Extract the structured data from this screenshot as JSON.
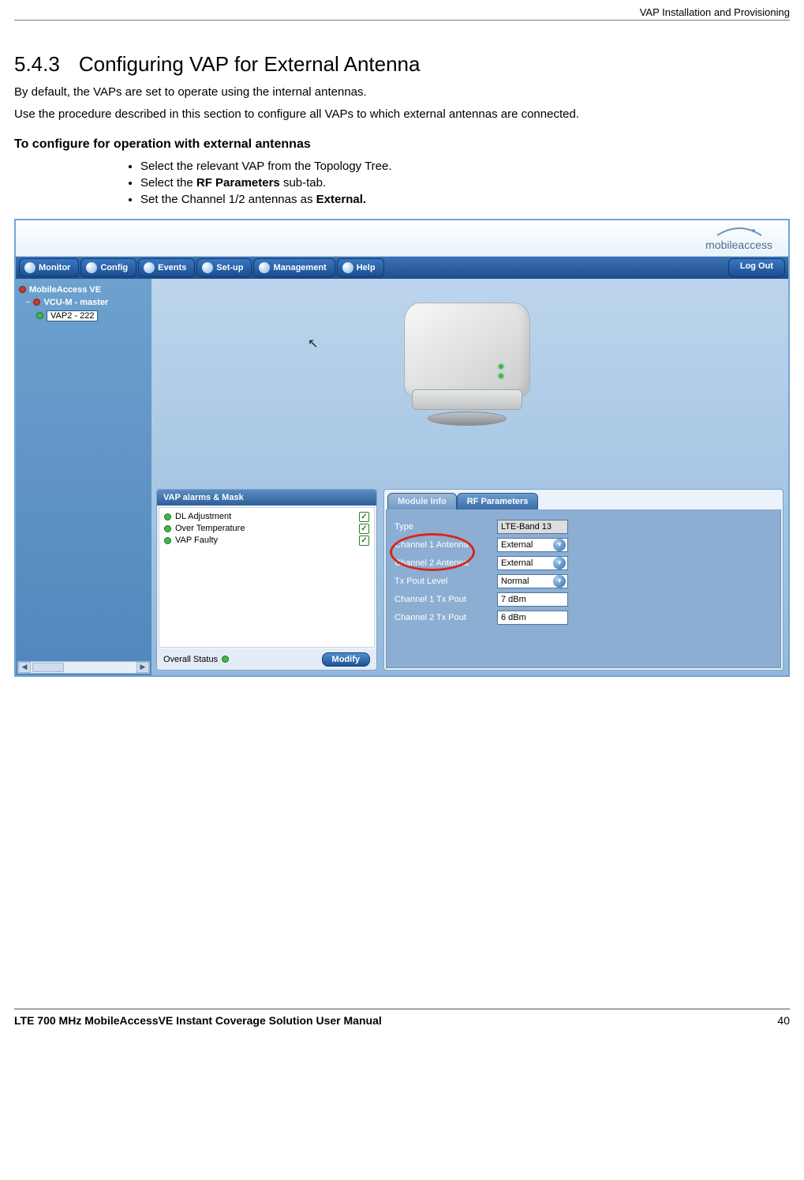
{
  "header": {
    "right": "VAP Installation and Provisioning"
  },
  "section": {
    "num": "5.4.3",
    "title": "Configuring VAP for External Antenna"
  },
  "paras": {
    "p1": "By default, the VAPs are set to operate using the internal antennas.",
    "p2": "Use the procedure described in this section to configure all VAPs to which external antennas are connected.",
    "sub": "To configure for operation with external antennas"
  },
  "bullets": {
    "b1": "Select the relevant VAP from the Topology Tree.",
    "b2_a": "Select the ",
    "b2_b": "RF Parameters",
    "b2_c": " sub-tab.",
    "b3_a": "Set the Channel 1/2 antennas as ",
    "b3_b": "External."
  },
  "brand": "mobileaccess",
  "nav": {
    "monitor": "Monitor",
    "config": "Config",
    "events": "Events",
    "setup": "Set-up",
    "management": "Management",
    "help": "Help",
    "logout": "Log Out"
  },
  "tree": {
    "root": "MobileAccess VE",
    "child": "VCU-M - master",
    "grand": "VAP2 - 222"
  },
  "alarms": {
    "title": "VAP alarms & Mask",
    "items": [
      "DL Adjustment",
      "Over Temperature",
      "VAP Faulty"
    ],
    "overall_label": "Overall Status",
    "modify": "Modify"
  },
  "tabs": {
    "module": "Module Info",
    "rf": "RF Parameters"
  },
  "rf": {
    "type_label": "Type",
    "type_value": "LTE-Band 13",
    "ch1a_label": "Channel 1 Antenna",
    "ch1a_value": "External",
    "ch2a_label": "Channel 2 Antenna",
    "ch2a_value": "External",
    "txlvl_label": "Tx Pout Level",
    "txlvl_value": "Normal",
    "ch1p_label": "Channel 1 Tx Pout",
    "ch1p_value": "7 dBm",
    "ch2p_label": "Channel 2 Tx Pout",
    "ch2p_value": "6 dBm"
  },
  "footer": {
    "left": "LTE 700 MHz MobileAccessVE Instant Coverage Solution User Manual",
    "right": "40"
  }
}
